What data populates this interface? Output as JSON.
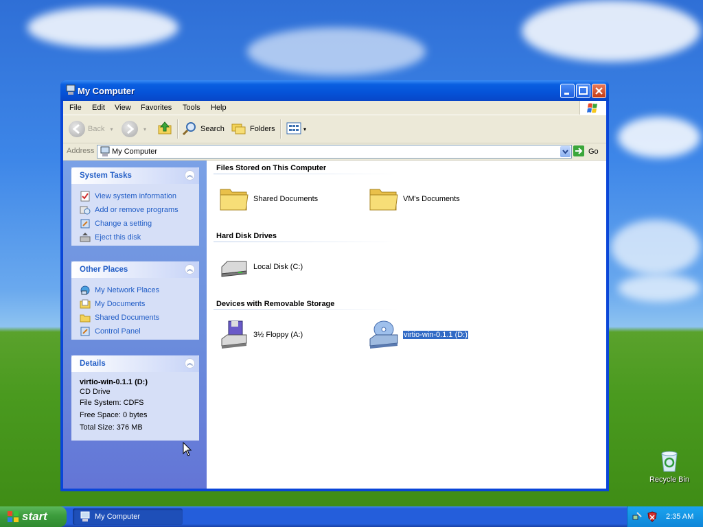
{
  "window": {
    "title": "My Computer"
  },
  "menu": [
    "File",
    "Edit",
    "View",
    "Favorites",
    "Tools",
    "Help"
  ],
  "toolbar": {
    "back": "Back",
    "search": "Search",
    "folders": "Folders"
  },
  "address": {
    "label": "Address",
    "value": "My Computer",
    "go": "Go"
  },
  "tasks": {
    "system": {
      "title": "System Tasks",
      "items": [
        "View system information",
        "Add or remove programs",
        "Change a setting",
        "Eject this disk"
      ]
    },
    "other": {
      "title": "Other Places",
      "items": [
        "My Network Places",
        "My Documents",
        "Shared Documents",
        "Control Panel"
      ]
    },
    "details": {
      "title": "Details",
      "name": "virtio-win-0.1.1 (D:)",
      "type": "CD Drive",
      "fs": "File System: CDFS",
      "free": "Free Space: 0 bytes",
      "total": "Total Size: 376 MB"
    }
  },
  "groups": {
    "files": {
      "title": "Files Stored on This Computer",
      "items": [
        "Shared Documents",
        "VM's Documents"
      ]
    },
    "hdd": {
      "title": "Hard Disk Drives",
      "items": [
        "Local Disk (C:)"
      ]
    },
    "removable": {
      "title": "Devices with Removable Storage",
      "items": [
        "3½ Floppy (A:)",
        "virtio-win-0.1.1 (D:)"
      ]
    }
  },
  "desktop": {
    "recycle_bin": "Recycle Bin"
  },
  "taskbar": {
    "start": "start",
    "task": "My Computer",
    "clock": "2:35 AM"
  }
}
